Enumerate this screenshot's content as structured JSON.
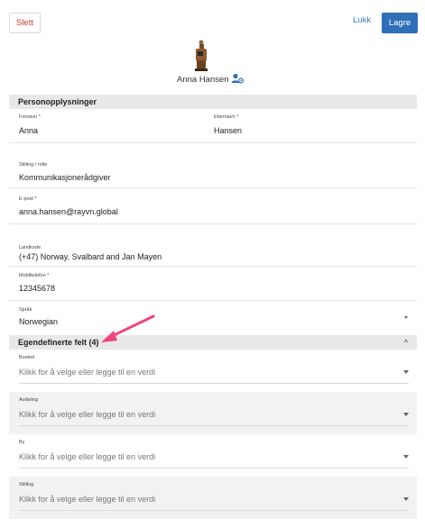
{
  "toolbar": {
    "delete_label": "Slett",
    "close_label": "Lukk",
    "save_label": "Lagre"
  },
  "profile": {
    "name": "Anna Hansen"
  },
  "personal": {
    "header": "Personopplysninger",
    "first_name_label": "Fornavn *",
    "first_name_value": "Anna",
    "last_name_label": "Etternavn *",
    "last_name_value": "Hansen",
    "role_label": "Stilling / rolle",
    "role_value": "Kommunikasjonerådgiver",
    "email_label": "E-post *",
    "email_value": "anna.hansen@rayvn.global",
    "country_code_label": "Landkode",
    "country_code_value": "(+47) Norway, Svalbard and Jan Mayen",
    "mobile_label": "Mobiltelefon *",
    "mobile_value": "12345678",
    "language_label": "Språk",
    "language_value": "Norwegian"
  },
  "custom": {
    "header": "Egendefinerte felt (4)",
    "fields": [
      {
        "label": "Bosted",
        "placeholder": "Klikk for å velge eller legge til en verdi"
      },
      {
        "label": "Avdeling",
        "placeholder": "Klikk for å velge eller legge til en verdi"
      },
      {
        "label": "By",
        "placeholder": "Klikk for å velge eller legge til en verdi"
      },
      {
        "label": "Stilling",
        "placeholder": "Klikk for å velge eller legge til en verdi"
      }
    ]
  },
  "colors": {
    "accent": "#2f6fb7",
    "danger": "#c0392b",
    "annotation": "#f0447a"
  }
}
